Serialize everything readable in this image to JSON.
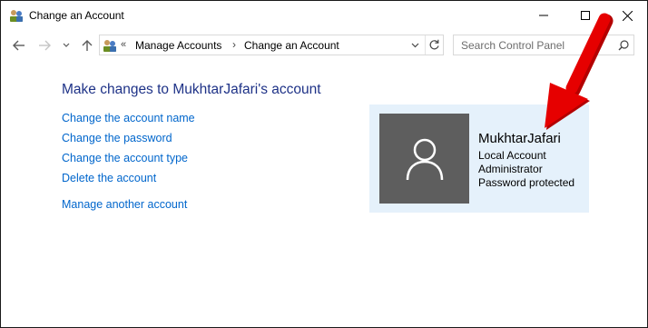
{
  "window": {
    "title": "Change an Account",
    "icon": "user-accounts-icon"
  },
  "titlebar_buttons": {
    "minimize": "minimize-icon",
    "maximize": "maximize-icon",
    "close": "close-icon"
  },
  "navigation": {
    "back": "back-arrow-icon",
    "forward": "forward-arrow-icon",
    "recent": "chevron-down-icon",
    "up": "up-arrow-icon"
  },
  "address": {
    "overflow": "«",
    "breadcrumbs": [
      "Manage Accounts",
      "Change an Account"
    ],
    "separator": "›"
  },
  "search": {
    "placeholder": "Search Control Panel"
  },
  "main": {
    "heading": "Make changes to MukhtarJafari's account",
    "links": [
      "Change the account name",
      "Change the password",
      "Change the account type",
      "Delete the account",
      "Manage another account"
    ]
  },
  "account": {
    "name": "MukhtarJafari",
    "type": "Local Account",
    "role": "Administrator",
    "security": "Password protected"
  },
  "colors": {
    "link": "#0066cc",
    "heading": "#1e3287",
    "card_background": "#e5f1fb",
    "avatar_background": "#5e5e5e",
    "annotation_arrow": "#e60000"
  }
}
